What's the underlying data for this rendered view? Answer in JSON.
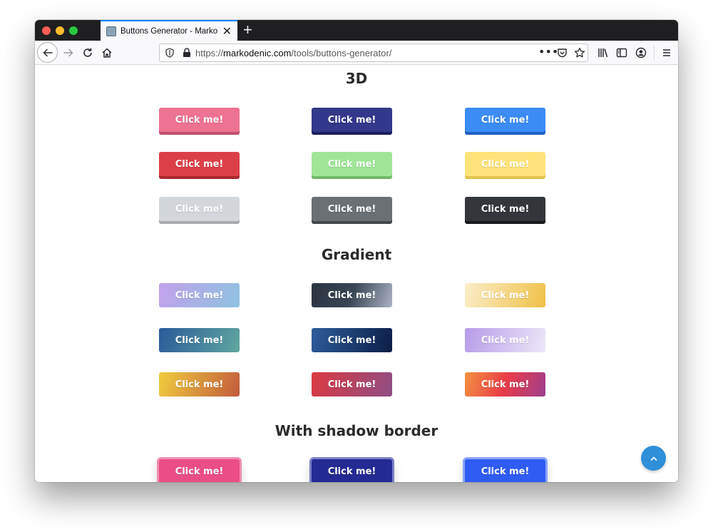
{
  "browser": {
    "tab_title": "Buttons Generator - Marko Denic",
    "url_prefix": "https://",
    "url_host": "markodenic.com",
    "url_path": "/tools/buttons-generator/",
    "new_tab_symbol": "+",
    "tab_close_symbol": "✕",
    "icons": [
      "back-icon",
      "forward-icon",
      "reload-icon",
      "home-icon",
      "shield-icon",
      "lock-icon",
      "more-icon",
      "pocket-icon",
      "bookmark-star-icon",
      "library-icon",
      "sidebar-icon",
      "account-icon",
      "menu-icon"
    ]
  },
  "sections": {
    "three_d": {
      "title": "3D",
      "buttons": [
        {
          "label": "Click me!",
          "color": "#ee7392",
          "edge": "#c14f6f"
        },
        {
          "label": "Click me!",
          "color": "#33388a",
          "edge": "#1c1f5c"
        },
        {
          "label": "Click me!",
          "color": "#3b8cf5",
          "edge": "#1f5fc2"
        },
        {
          "label": "Click me!",
          "color": "#dc3f47",
          "edge": "#a82a30"
        },
        {
          "label": "Click me!",
          "color": "#9ee696",
          "edge": "#6fb969"
        },
        {
          "label": "Click me!",
          "color": "#fde37a",
          "edge": "#e3c14c"
        },
        {
          "label": "Click me!",
          "color": "#d3d7db",
          "edge": "#a7abaf"
        },
        {
          "label": "Click me!",
          "color": "#6a7074",
          "edge": "#45494c"
        },
        {
          "label": "Click me!",
          "color": "#33373b",
          "edge": "#17191b"
        }
      ]
    },
    "gradient": {
      "title": "Gradient",
      "buttons": [
        {
          "label": "Click me!",
          "from": "#c3a1ec",
          "to": "#8ec2e0"
        },
        {
          "label": "Click me!",
          "from": "#2b3441",
          "mid": "#3a4656",
          "to": "#aab3c4"
        },
        {
          "label": "Click me!",
          "from": "#fbeecc",
          "to": "#f0c046"
        },
        {
          "label": "Click me!",
          "from": "#2a5b99",
          "to": "#5fa6a0"
        },
        {
          "label": "Click me!",
          "from": "#2d5e9c",
          "to": "#0c1e45"
        },
        {
          "label": "Click me!",
          "from": "#b69be8",
          "to": "#ece7f8"
        },
        {
          "label": "Click me!",
          "from": "#f0cd3e",
          "to": "#c25a3c"
        },
        {
          "label": "Click me!",
          "from": "#dc3a40",
          "to": "#8e4d86"
        },
        {
          "label": "Click me!",
          "from": "#f39340",
          "mid": "#ea3b48",
          "to": "#9c3f8e"
        }
      ]
    },
    "shadow_border": {
      "title": "With shadow border",
      "buttons": [
        {
          "label": "Click me!",
          "color": "#ea4e85",
          "glow": "#f08fb1"
        },
        {
          "label": "Click me!",
          "color": "#232a93",
          "glow": "#7b80c7"
        },
        {
          "label": "Click me!",
          "color": "#2f5cf2",
          "glow": "#8aa5f8"
        }
      ]
    }
  },
  "scroll_top": {
    "icon": "chevron-up-icon",
    "color": "#2f8fd8"
  }
}
